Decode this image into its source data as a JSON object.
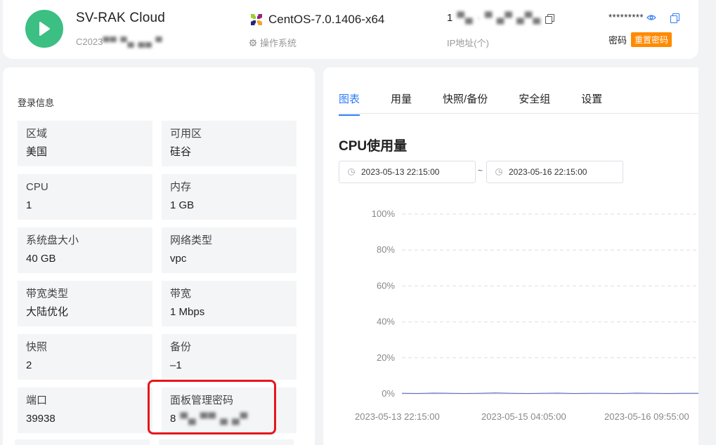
{
  "header": {
    "server_name": "SV-RAK Cloud",
    "server_id_prefix": "C2023",
    "server_id_masked": "▀▀ ▀▄ ▄▄ ▀",
    "os_name": "CentOS-7.0.1406-x64",
    "os_label": "操作系统",
    "ip_prefix": "1",
    "ip_masked": "▀▄ · ▀ ▄▀ ▄▀▄",
    "ip_label": "IP地址(个)",
    "password_mask": "*********",
    "password_label": "密码",
    "reset_password": "重置密码"
  },
  "info": {
    "title": "登录信息",
    "items": [
      {
        "key": "区域",
        "value": "美国"
      },
      {
        "key": "可用区",
        "value": "硅谷"
      },
      {
        "key": "CPU",
        "value": "1"
      },
      {
        "key": "内存",
        "value": "1 GB"
      },
      {
        "key": "系统盘大小",
        "value": "40 GB"
      },
      {
        "key": "网络类型",
        "value": "vpc"
      },
      {
        "key": "带宽类型",
        "value": "大陆优化"
      },
      {
        "key": "带宽",
        "value": "1 Mbps"
      },
      {
        "key": "快照",
        "value": "2"
      },
      {
        "key": "备份",
        "value": "–1"
      },
      {
        "key": "端口",
        "value": "39938"
      },
      {
        "key": "面板管理密码",
        "value": "8",
        "masked": "▀▄ ▀▀ ▄ ▄▀"
      }
    ]
  },
  "tabs": [
    {
      "label": "图表",
      "active": true
    },
    {
      "label": "用量",
      "active": false
    },
    {
      "label": "快照/备份",
      "active": false
    },
    {
      "label": "安全组",
      "active": false
    },
    {
      "label": "设置",
      "active": false
    }
  ],
  "chart_section": {
    "title": "CPU使用量",
    "start_date": "2023-05-13 22:15:00",
    "separator": "~",
    "end_date": "2023-05-16 22:15:00"
  },
  "colors": {
    "accent": "#2f7cf6",
    "start_button": "#3cbf82",
    "reset_button": "#ff8a00",
    "highlight_box": "#e8161b"
  },
  "chart_data": {
    "type": "line",
    "title": "",
    "xlabel": "",
    "ylabel": "",
    "y_ticks": [
      "100%",
      "80%",
      "60%",
      "40%",
      "20%",
      "0%"
    ],
    "y_tick_values": [
      100,
      80,
      60,
      40,
      20,
      0
    ],
    "ylim": [
      0,
      100
    ],
    "x_ticks": [
      "2023-05-13 22:15:00",
      "2023-05-15 04:05:00",
      "2023-05-16 09:55:00"
    ],
    "grid": true,
    "series": [
      {
        "values": [
          0.3,
          0.2,
          0.4,
          0.3,
          0.2,
          0.3,
          0.5,
          0.3,
          0.2,
          0.3,
          0.4,
          0.2,
          0.3,
          0.3,
          0.2,
          0.4,
          0.3,
          0.2,
          0.3,
          0.3
        ]
      }
    ]
  }
}
